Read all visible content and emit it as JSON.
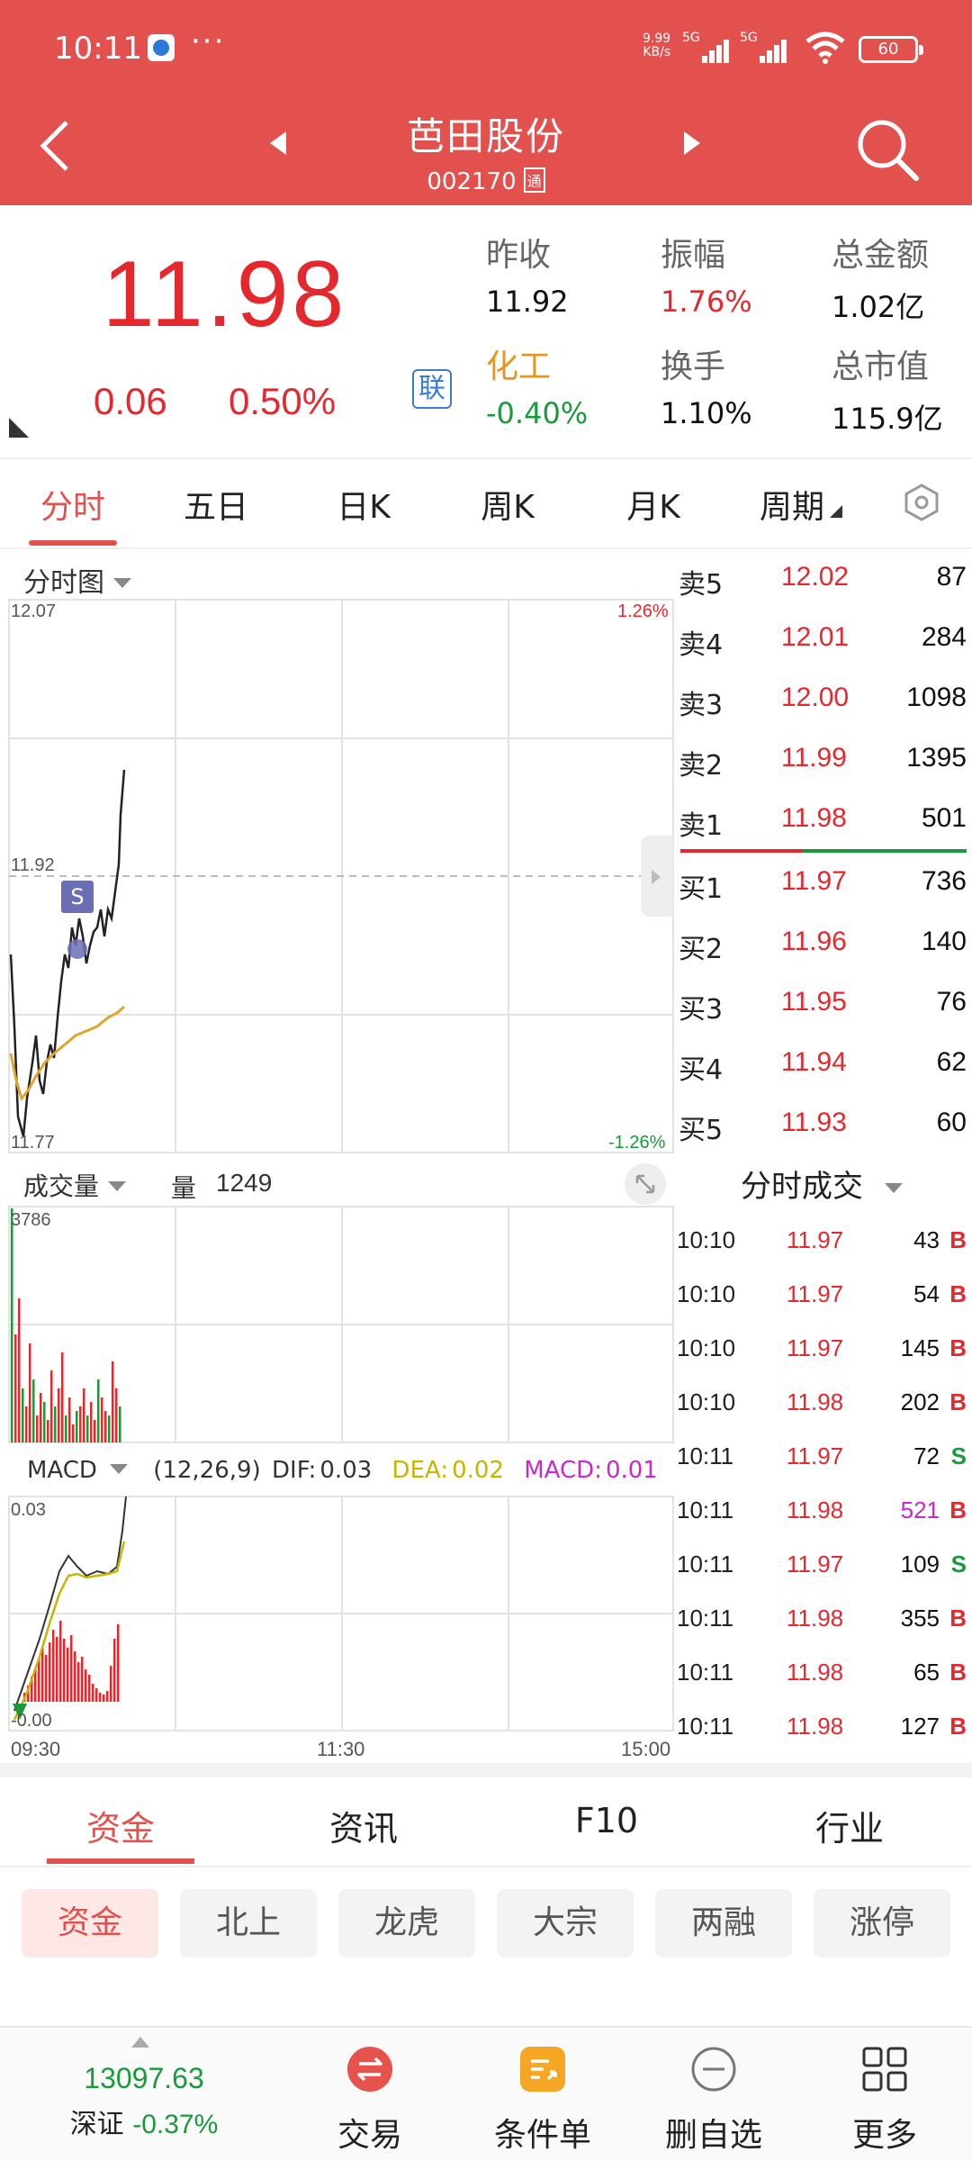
{
  "status_bar": {
    "time": "10:11",
    "dots": "···",
    "net_speed": "9.99",
    "net_unit": "KB/s",
    "sig1": "5G",
    "sig2": "5G",
    "battery": "60"
  },
  "header": {
    "name": "芭田股份",
    "code": "002170",
    "tong": "通"
  },
  "quote": {
    "price": "11.98",
    "change": "0.06",
    "change_pct": "0.50%",
    "lian": "联",
    "cells": [
      {
        "k": "昨收",
        "v": "11.92"
      },
      {
        "k": "振幅",
        "v": "1.76%"
      },
      {
        "k": "总金额",
        "v": "1.02亿"
      },
      {
        "k": "化工",
        "v": "-0.40%"
      },
      {
        "k": "换手",
        "v": "1.10%"
      },
      {
        "k": "总市值",
        "v": "115.9亿"
      }
    ],
    "colors": {
      "up": "#e4282e",
      "down": "#1a9a3a",
      "sector": "#e8951a"
    }
  },
  "period_tabs": [
    "分时",
    "五日",
    "日K",
    "周K",
    "月K",
    "周期"
  ],
  "chart": {
    "title": "分时图",
    "price_high": "12.07",
    "pct_high": "1.26%",
    "price_mid": "11.92",
    "price_low": "11.77",
    "pct_low": "-1.26%",
    "s_marker": "S",
    "volume_title": "成交量",
    "volume_label": "量",
    "volume_value": "1249",
    "volume_max": "3786",
    "macd_title": "MACD",
    "macd_params": "(12,26,9)",
    "dif_label": "DIF:",
    "dif": "0.03",
    "dea_label": "DEA:",
    "dea": "0.02",
    "macd_label": "MACD:",
    "macd": "0.01",
    "macd_max": "0.03",
    "macd_min": "-0.00",
    "times": [
      "09:30",
      "11:30",
      "15:00"
    ]
  },
  "order_book": {
    "asks": [
      {
        "label": "卖5",
        "price": "12.02",
        "vol": "87"
      },
      {
        "label": "卖4",
        "price": "12.01",
        "vol": "284"
      },
      {
        "label": "卖3",
        "price": "12.00",
        "vol": "1098"
      },
      {
        "label": "卖2",
        "price": "11.99",
        "vol": "1395"
      },
      {
        "label": "卖1",
        "price": "11.98",
        "vol": "501"
      }
    ],
    "bids": [
      {
        "label": "买1",
        "price": "11.97",
        "vol": "736"
      },
      {
        "label": "买2",
        "price": "11.96",
        "vol": "140"
      },
      {
        "label": "买3",
        "price": "11.95",
        "vol": "76"
      },
      {
        "label": "买4",
        "price": "11.94",
        "vol": "62"
      },
      {
        "label": "买5",
        "price": "11.93",
        "vol": "60"
      }
    ]
  },
  "ticks": {
    "title": "分时成交",
    "rows": [
      {
        "time": "10:10",
        "price": "11.97",
        "vol": "43",
        "side": "B"
      },
      {
        "time": "10:10",
        "price": "11.97",
        "vol": "54",
        "side": "B"
      },
      {
        "time": "10:10",
        "price": "11.97",
        "vol": "145",
        "side": "B"
      },
      {
        "time": "10:10",
        "price": "11.98",
        "vol": "202",
        "side": "B"
      },
      {
        "time": "10:11",
        "price": "11.97",
        "vol": "72",
        "side": "S"
      },
      {
        "time": "10:11",
        "price": "11.98",
        "vol": "521",
        "side": "B"
      },
      {
        "time": "10:11",
        "price": "11.97",
        "vol": "109",
        "side": "S"
      },
      {
        "time": "10:11",
        "price": "11.98",
        "vol": "355",
        "side": "B"
      },
      {
        "time": "10:11",
        "price": "11.98",
        "vol": "65",
        "side": "B"
      },
      {
        "time": "10:11",
        "price": "11.98",
        "vol": "127",
        "side": "B"
      }
    ]
  },
  "info_tabs": [
    "资金",
    "资讯",
    "F10",
    "行业"
  ],
  "chips": [
    "资金",
    "北上",
    "龙虎",
    "大宗",
    "两融",
    "涨停"
  ],
  "bottom_bar": {
    "index_value": "13097.63",
    "index_name": "深证",
    "index_change": "-0.37%",
    "items": [
      "交易",
      "条件单",
      "删自选",
      "更多"
    ]
  }
}
